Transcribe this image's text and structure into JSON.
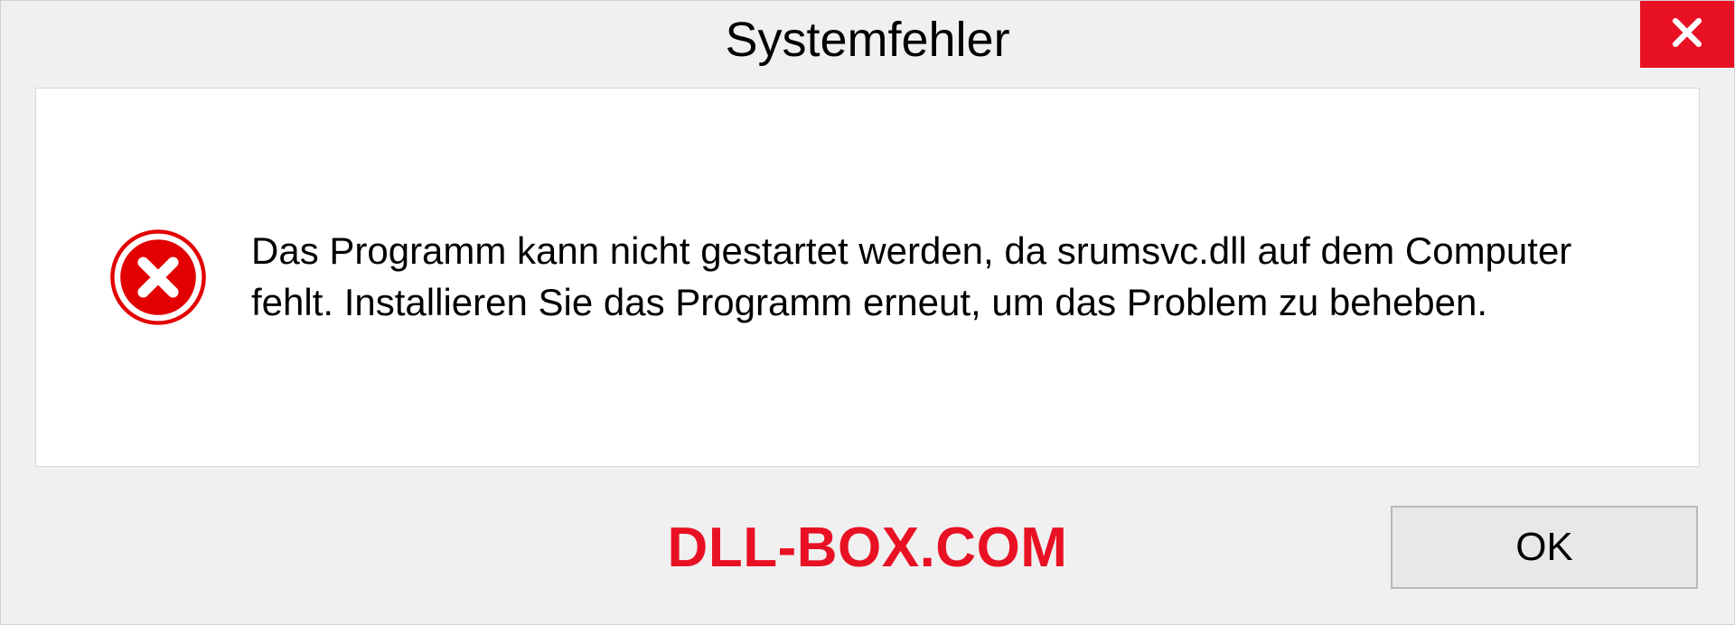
{
  "dialog": {
    "title": "Systemfehler",
    "message": "Das Programm kann nicht gestartet werden, da srumsvc.dll auf dem Computer fehlt. Installieren Sie das Programm erneut, um das Problem zu beheben.",
    "ok_label": "OK"
  },
  "watermark": "DLL-BOX.COM"
}
